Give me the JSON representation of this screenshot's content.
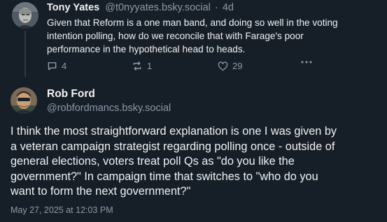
{
  "reply": {
    "author_name": "Tony Yates",
    "author_handle": "@t0nyyates.bsky.social",
    "separator": "·",
    "age": "4d",
    "text_lines": [
      "Given that Reform is a one man band, and doing so well in the voting",
      "intention polling, how do we reconcile that with Farage's poor",
      "performance in the hypothetical head to heads."
    ],
    "actions": {
      "reply_icon": "speech-bubble-icon",
      "reply_count": "4",
      "repost_icon": "repost-icon",
      "repost_count": "1",
      "like_icon": "heart-icon",
      "like_count": "29",
      "more_icon": "ellipsis-icon"
    }
  },
  "post": {
    "author_name": "Rob Ford",
    "author_handle": "@robfordmancs.bsky.social",
    "text_lines": [
      "I think the most straightforward explanation is one I was given by",
      "a veteran campaign strategist regarding polling once - outside of",
      "general elections, voters treat poll Qs as \"do you like the",
      "government?\" In campaign time that switches to \"who do you",
      "want to form the next government?\""
    ],
    "timestamp": "May 27, 2025 at 12:03 PM"
  },
  "colors": {
    "background": "#161e27",
    "text": "#f1f3f5",
    "muted": "#8d9aa8",
    "thread_line": "#2e3a47"
  }
}
